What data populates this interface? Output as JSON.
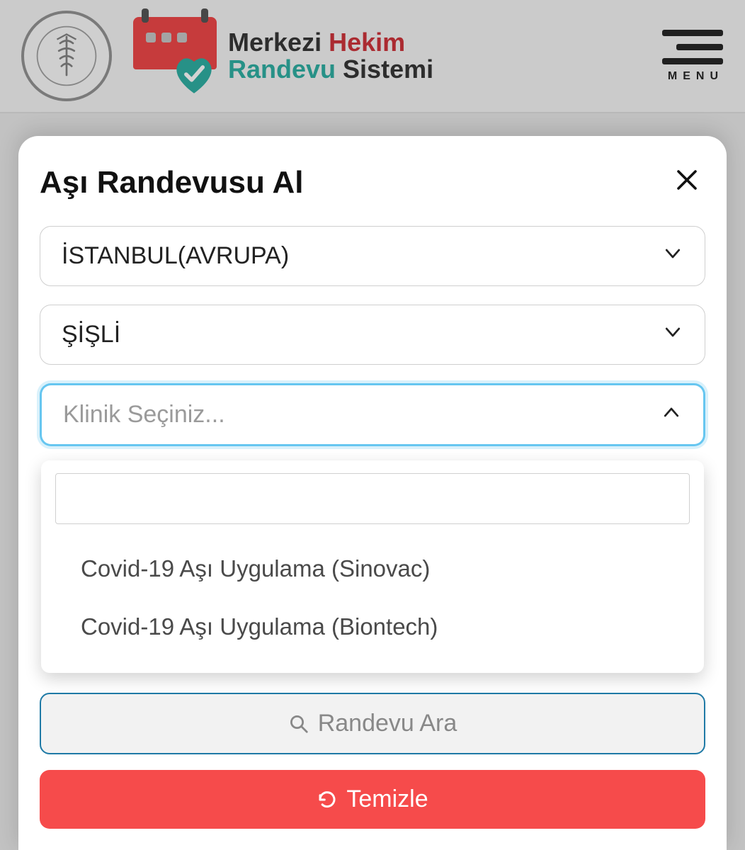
{
  "header": {
    "brand_part1": "Merkezi ",
    "brand_part2": "Hekim",
    "brand_part3": "Randevu ",
    "brand_part4": "Sistemi",
    "menu_label": "MENU"
  },
  "modal": {
    "title": "Aşı Randevusu Al",
    "province": "İSTANBUL(AVRUPA)",
    "district": "ŞİŞLİ",
    "clinic_placeholder": "Klinik Seçiniz...",
    "clinic_options": [
      "Covid-19 Aşı Uygulama (Sinovac)",
      "Covid-19 Aşı Uygulama (Biontech)"
    ],
    "search_button": "Randevu Ara",
    "clear_button": "Temizle"
  }
}
